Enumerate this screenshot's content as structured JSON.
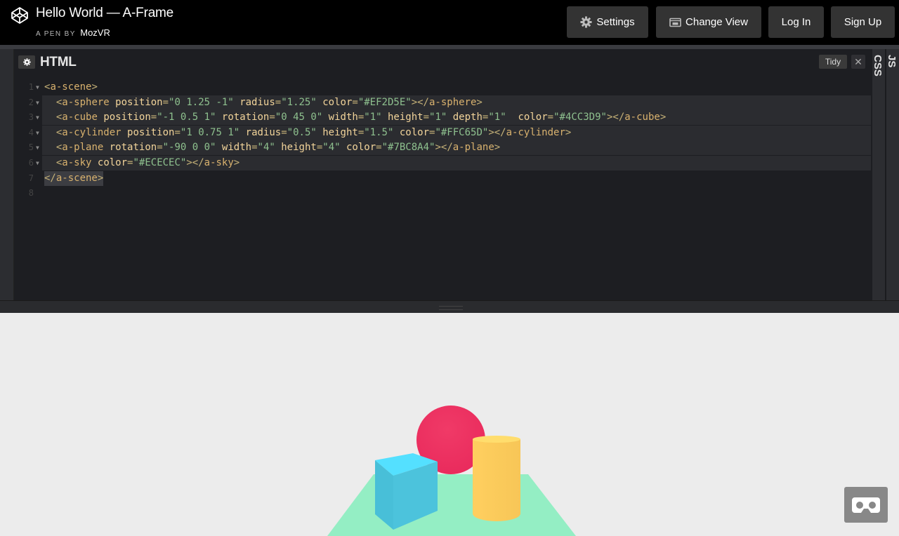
{
  "header": {
    "title": "Hello World — A-Frame",
    "by_label": "A PEN BY",
    "author": "MozVR"
  },
  "toolbar": {
    "settings_label": "Settings",
    "change_view_label": "Change View",
    "login_label": "Log In",
    "signup_label": "Sign Up"
  },
  "editor": {
    "title": "HTML",
    "tidy_label": "Tidy",
    "close_glyph": "✕",
    "side_tabs": [
      "CSS",
      "JS"
    ],
    "line_numbers": [
      "1",
      "2",
      "3",
      "4",
      "5",
      "6",
      "7",
      "8"
    ],
    "lines": [
      "<a-scene>",
      "  <a-sphere position=\"0 1.25 -1\" radius=\"1.25\" color=\"#EF2D5E\"></a-sphere>",
      "  <a-cube position=\"-1 0.5 1\" rotation=\"0 45 0\" width=\"1\" height=\"1\" depth=\"1\"  color=\"#4CC3D9\"></a-cube>",
      "  <a-cylinder position=\"1 0.75 1\" radius=\"0.5\" height=\"1.5\" color=\"#FFC65D\"></a-cylinder>",
      "  <a-plane rotation=\"-90 0 0\" width=\"4\" height=\"4\" color=\"#7BC8A4\"></a-plane>",
      "  <a-sky color=\"#ECECEC\"></a-sky>",
      "</a-scene>",
      ""
    ]
  },
  "scene": {
    "sky_color": "#ECECEC",
    "plane_color": "#7BC8A4",
    "sphere_color": "#EF2D5E",
    "cube_color": "#4CC3D9",
    "cylinder_color": "#FFC65D"
  },
  "icons": {
    "logo": "codepen-logo-icon",
    "settings": "gear-icon",
    "change_view": "change-view-icon",
    "vr": "vr-headset-icon"
  },
  "colors": {
    "header_bg": "#000000",
    "button_bg": "#333333",
    "editor_bg": "#1d1e22"
  }
}
